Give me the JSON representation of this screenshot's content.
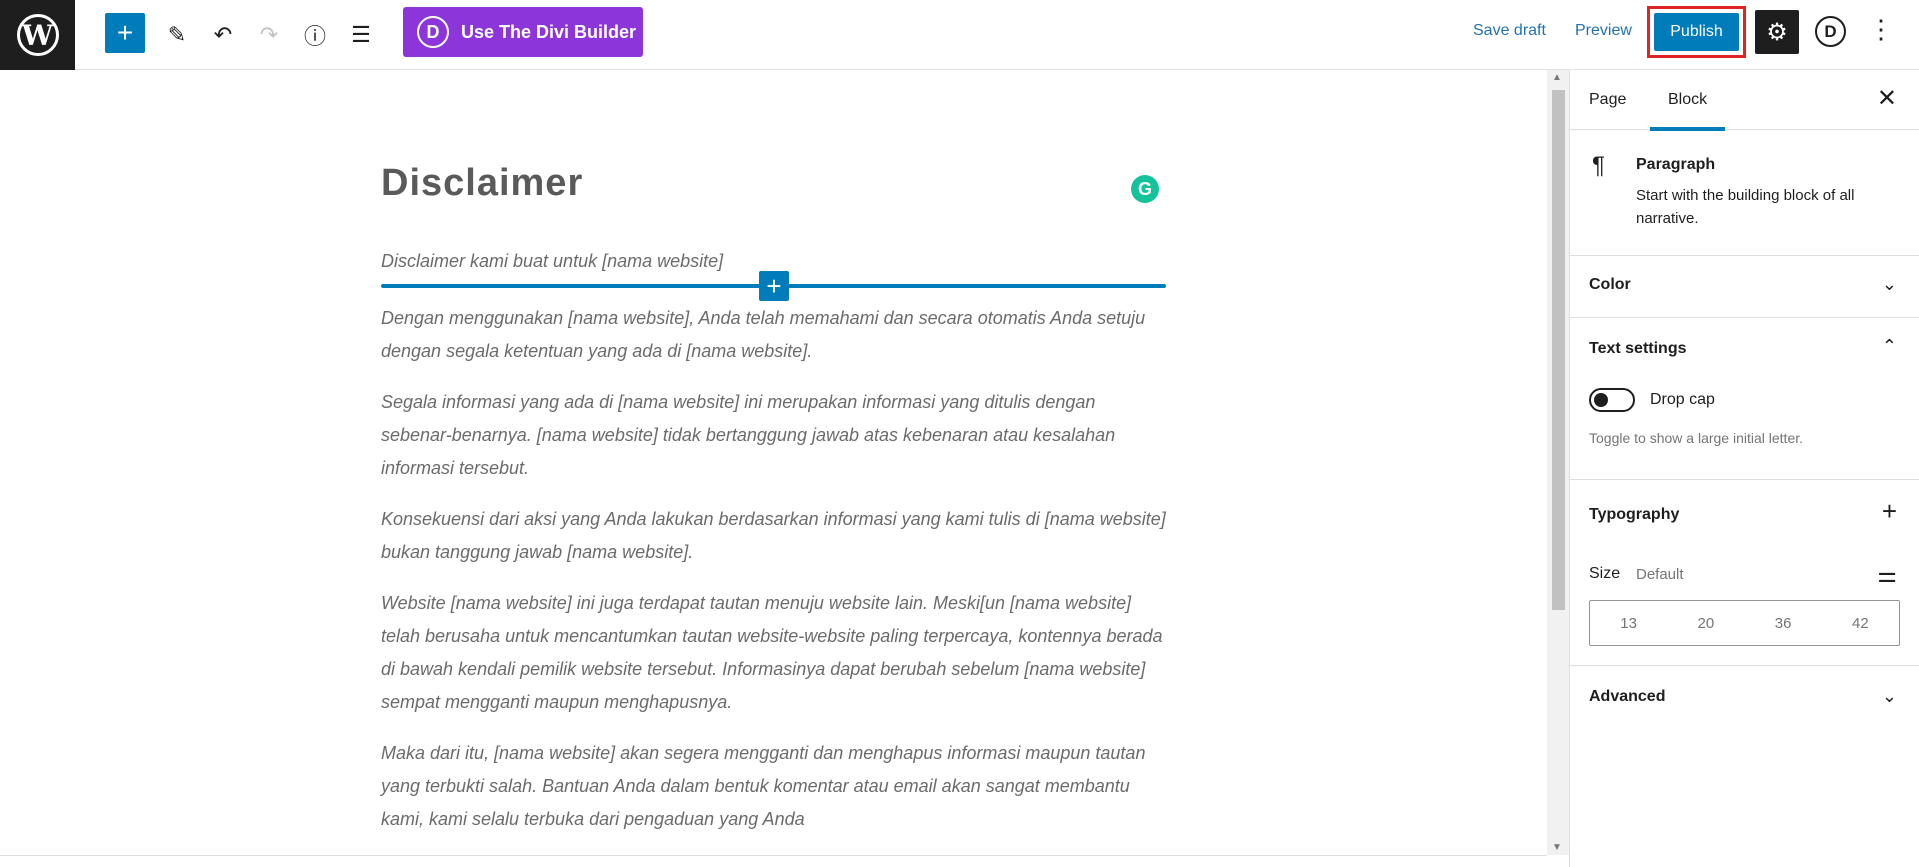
{
  "toolbar": {
    "divi_label": "Use The Divi Builder",
    "save_draft": "Save draft",
    "preview": "Preview",
    "publish": "Publish",
    "divi_letter": "D"
  },
  "editor": {
    "title": "Disclaimer",
    "paragraphs": [
      "Disclaimer kami buat untuk [nama website]",
      "Dengan menggunakan [nama website], Anda telah memahami dan secara otomatis Anda setuju dengan segala ketentuan yang ada di [nama website].",
      "Segala informasi yang ada di [nama website] ini merupakan informasi yang ditulis dengan sebenar-benarnya. [nama website] tidak bertanggung jawab atas kebenaran atau kesalahan informasi tersebut.",
      "Konsekuensi dari aksi yang Anda lakukan berdasarkan informasi yang kami tulis di [nama website] bukan tanggung jawab [nama website].",
      "Website [nama website] ini juga terdapat tautan menuju website lain. Meski[un [nama website] telah berusaha untuk mencantumkan tautan website-website paling terpercaya, kontennya berada di bawah kendali pemilik website tersebut. Informasinya dapat berubah sebelum [nama website] sempat mengganti maupun menghapusnya.",
      "Maka dari itu, [nama website] akan segera mengganti dan menghapus informasi maupun tautan yang terbukti salah. Bantuan Anda dalam bentuk komentar atau email akan sangat membantu kami, kami selalu terbuka dari pengaduan yang Anda"
    ]
  },
  "sidebar": {
    "tabs": [
      {
        "label": "Page"
      },
      {
        "label": "Block"
      }
    ],
    "block": {
      "name": "Paragraph",
      "description": "Start with the building block of all narrative."
    },
    "color": "Color",
    "text_settings": {
      "title": "Text settings",
      "drop_cap": "Drop cap",
      "help": "Toggle to show a large initial letter."
    },
    "typography": {
      "title": "Typography",
      "size_label": "Size",
      "size_default": "Default",
      "sizes": [
        "13",
        "20",
        "36",
        "42"
      ]
    },
    "advanced": "Advanced"
  }
}
